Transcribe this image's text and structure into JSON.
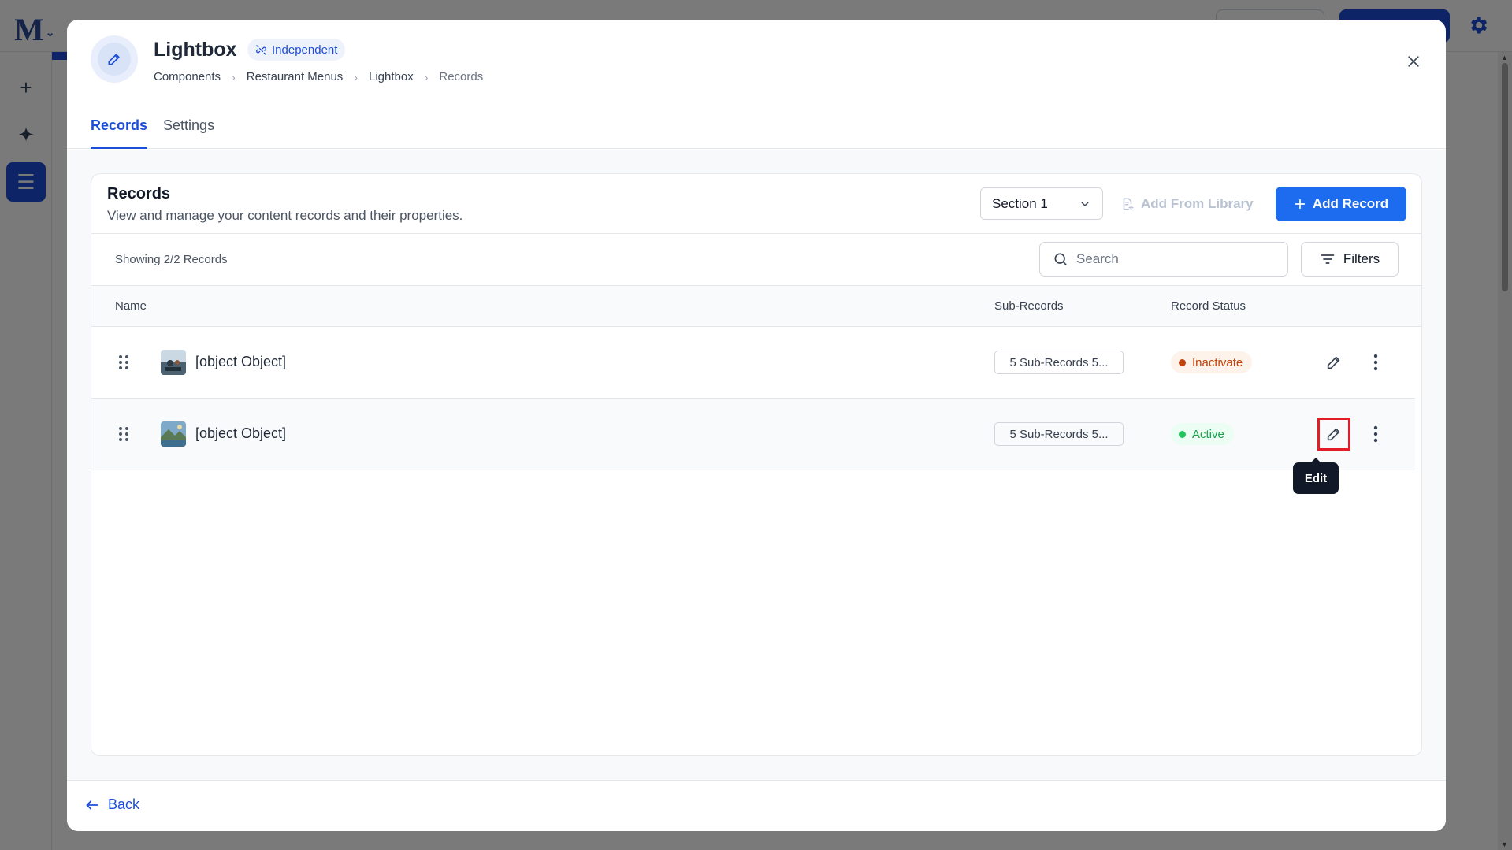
{
  "app": {
    "logo": "M"
  },
  "modal": {
    "title": "Lightbox",
    "badge": "Independent",
    "breadcrumb": [
      "Components",
      "Restaurant Menus",
      "Lightbox",
      "Records"
    ],
    "tabs": [
      {
        "label": "Records",
        "active": true
      },
      {
        "label": "Settings",
        "active": false
      }
    ],
    "footer": {
      "back_label": "Back"
    }
  },
  "records_card": {
    "title": "Records",
    "subtitle": "View and manage your content records and their properties.",
    "section_select": {
      "value": "Section 1"
    },
    "add_from_library_label": "Add From Library",
    "add_record_label": "Add Record",
    "showing_text": "Showing 2/2 Records",
    "search": {
      "placeholder": "Search",
      "value": ""
    },
    "filters_label": "Filters",
    "columns": [
      "Name",
      "Sub-Records",
      "Record Status"
    ],
    "rows": [
      {
        "name": "[object Object]",
        "sub_records": "5 Sub-Records 5...",
        "status": "Inactivate",
        "status_kind": "inactive"
      },
      {
        "name": "[object Object]",
        "sub_records": "5 Sub-Records 5...",
        "status": "Active",
        "status_kind": "active"
      }
    ],
    "tooltip": "Edit"
  },
  "colors": {
    "primary": "#1d6cf0",
    "brand": "#1d4ed8",
    "inactive": "#c2410c",
    "active": "#16a34a",
    "highlight": "#e11d2a"
  },
  "icons": {
    "title": "pencil-icon",
    "badge": "unlink-icon",
    "close": "close-icon",
    "select": "chevron-down-icon",
    "add_library": "document-add-icon",
    "add_record": "plus-icon",
    "search": "search-icon",
    "filters": "filter-icon",
    "drag": "drag-handle-icon",
    "edit": "pencil-icon",
    "more": "more-vertical-icon",
    "back": "arrow-left-icon"
  }
}
